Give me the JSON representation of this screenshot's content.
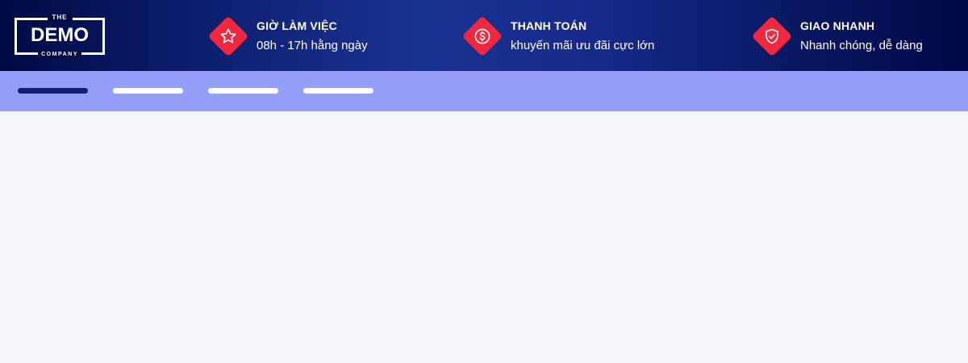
{
  "logo": {
    "top": "THE",
    "main": "DEMO",
    "bottom": "COMPANY"
  },
  "features": [
    {
      "icon": "star-icon",
      "title": "GIỜ LÀM VIỆC",
      "subtitle": "08h - 17h hằng ngày"
    },
    {
      "icon": "dollar-icon",
      "title": "THANH TOÁN",
      "subtitle": "khuyến mãi ưu đãi cực lớn"
    },
    {
      "icon": "shield-check-icon",
      "title": "GIAO NHANH",
      "subtitle": "Nhanh chóng, dễ dàng"
    }
  ],
  "colors": {
    "header_dark": "#000a44",
    "header_mid": "#1a3494",
    "badge_red": "#f0283f",
    "nav_bg": "#949ef6",
    "nav_active": "#102070",
    "content_bg": "#f4f4fa"
  },
  "nav": {
    "item_count": 4,
    "active_index": 0
  }
}
